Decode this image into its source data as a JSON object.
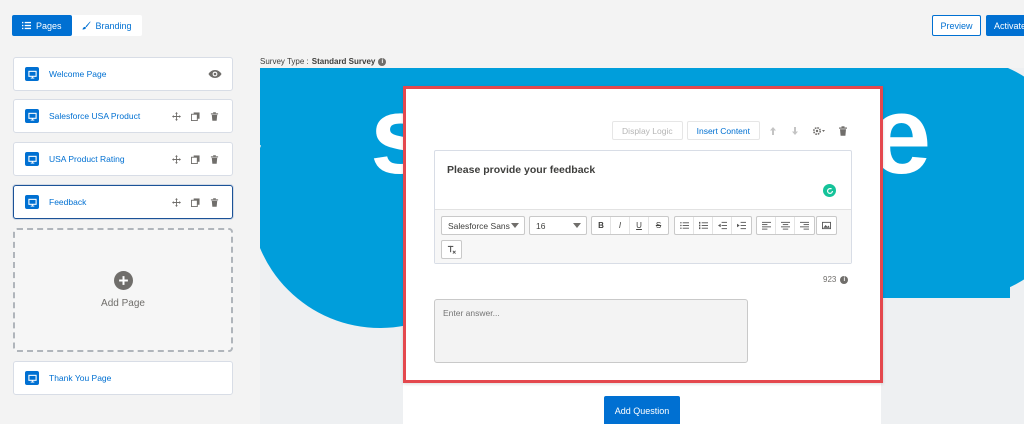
{
  "tabs": [
    {
      "label": "Pages",
      "icon": "list-icon",
      "active": true
    },
    {
      "label": "Branding",
      "icon": "brush-icon",
      "active": false
    }
  ],
  "header": {
    "preview_label": "Preview",
    "activate_label": "Activate"
  },
  "sidebar": {
    "pages": [
      {
        "label": "Welcome Page",
        "icon": "desktop-icon"
      },
      {
        "label": "Salesforce USA Product",
        "icon": "desktop-icon"
      },
      {
        "label": "USA Product Rating",
        "icon": "desktop-icon"
      },
      {
        "label": "Feedback",
        "icon": "desktop-icon",
        "selected": true
      }
    ],
    "add_page_label": "Add Page",
    "thank_you_label": "Thank You Page"
  },
  "survey": {
    "type_prefix": "Survey Type :",
    "type_value": "Standard Survey",
    "info": "i"
  },
  "question": {
    "display_logic_label": "Display Logic",
    "insert_content_label": "Insert Content",
    "text": "Please provide your feedback",
    "font_family": "Salesforce Sans",
    "font_size": "16",
    "format_buttons": [
      "B",
      "I",
      "U",
      "S"
    ],
    "char_count": "923",
    "answer_placeholder": "Enter answer..."
  },
  "add_question_label": "Add Question",
  "colors": {
    "brand_blue": "#0070d2",
    "highlight_red": "#e4484e",
    "background_blue": "#009edb"
  }
}
